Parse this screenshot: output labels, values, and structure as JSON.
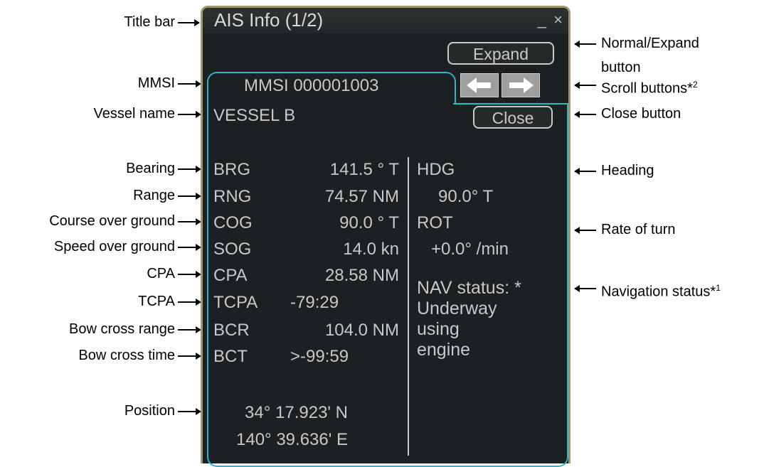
{
  "window": {
    "title": "AIS Info (1/2)",
    "controls": "_ ×",
    "expand_label": "Expand",
    "close_label": "Close",
    "mmsi": "MMSI 000001003",
    "vessel_name": "VESSEL B"
  },
  "fields": {
    "brg": {
      "label": "BRG",
      "value": "141.5 ° T"
    },
    "rng": {
      "label": "RNG",
      "value": "74.57 NM"
    },
    "cog": {
      "label": "COG",
      "value": "90.0 ° T"
    },
    "sog": {
      "label": "SOG",
      "value": "14.0 kn"
    },
    "cpa": {
      "label": "CPA",
      "value": "28.58 NM"
    },
    "tcpa": {
      "label": "TCPA",
      "value": "-79:29"
    },
    "bcr": {
      "label": "BCR",
      "value": "104.0 NM"
    },
    "bct": {
      "label": "BCT",
      "value": ">-99:59"
    },
    "lat": "34° 17.923'  N",
    "lon": "140° 39.636'  E",
    "hdg": {
      "label": "HDG",
      "value": "90.0° T"
    },
    "rot": {
      "label": "ROT",
      "value": "+0.0° /min"
    },
    "nav_status_1": "NAV status: *",
    "nav_status_2": "Underway",
    "nav_status_3": "using",
    "nav_status_4": "engine"
  },
  "callouts": {
    "title_bar": "Title bar",
    "mmsi": "MMSI",
    "vessel_name": "Vessel name",
    "bearing": "Bearing",
    "range": "Range",
    "cog": "Course over ground",
    "sog": "Speed over ground",
    "cpa": "CPA",
    "tcpa": "TCPA",
    "bcr": "Bow cross range",
    "bct": "Bow cross time",
    "position": "Position",
    "normal_expand_1": "Normal/Expand",
    "normal_expand_2": "button",
    "scroll_buttons": "Scroll buttons*",
    "scroll_note": "2",
    "close_button": "Close button",
    "heading": "Heading",
    "rate_of_turn": "Rate of turn",
    "nav_status": "Navigation status*",
    "nav_note": "1"
  }
}
